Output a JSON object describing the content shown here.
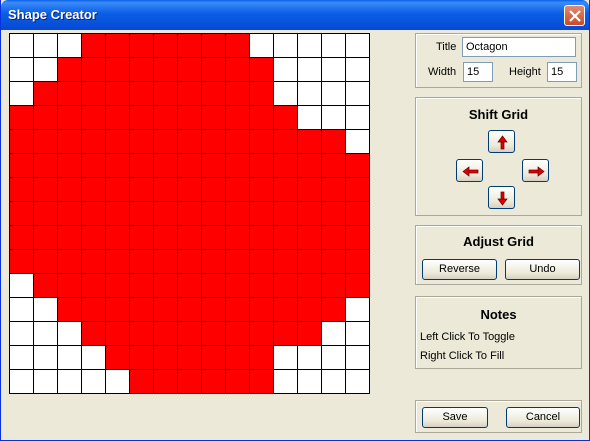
{
  "window": {
    "title": "Shape Creator"
  },
  "grid": {
    "rows": [
      "...#######.....",
      "..#########....",
      ".##########....",
      "############...",
      "##############.",
      "###############",
      "###############",
      "###############",
      "###############",
      "###############",
      ".##############",
      "..############.",
      "...##########..",
      "....#######....",
      ".....######...."
    ],
    "fill_color": "#ff0000",
    "empty_color": "#ffffff"
  },
  "props": {
    "title_label": "Title",
    "title_value": "Octagon",
    "width_label": "Width",
    "width_value": "15",
    "height_label": "Height",
    "height_value": "15"
  },
  "shift": {
    "heading": "Shift Grid"
  },
  "adjust": {
    "heading": "Adjust Grid",
    "reverse_label": "Reverse",
    "undo_label": "Undo"
  },
  "notes": {
    "heading": "Notes",
    "line1": "Left Click To Toggle",
    "line2": "Right Click To Fill"
  },
  "footer": {
    "save_label": "Save",
    "cancel_label": "Cancel"
  }
}
